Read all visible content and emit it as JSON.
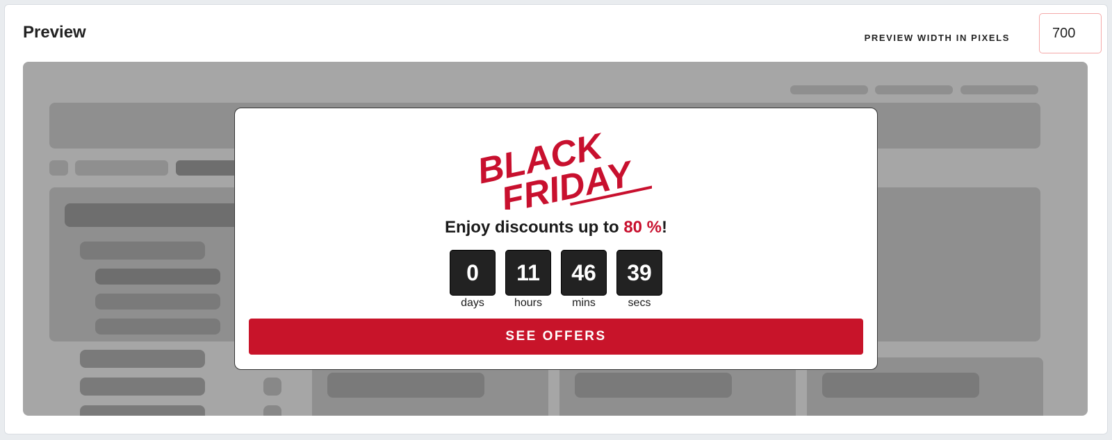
{
  "header": {
    "title": "Preview",
    "width_label": "PREVIEW WIDTH IN PIXELS",
    "width_value": "700"
  },
  "popup": {
    "logo_line1": "BLACK",
    "logo_line2": "FRIDAY",
    "headline_prefix": "Enjoy discounts up to ",
    "headline_highlight": "80 %",
    "headline_suffix": "!",
    "countdown": [
      {
        "value": "0",
        "label": "days"
      },
      {
        "value": "11",
        "label": "hours"
      },
      {
        "value": "46",
        "label": "mins"
      },
      {
        "value": "39",
        "label": "secs"
      }
    ],
    "cta_label": "SEE OFFERS"
  },
  "colors": {
    "brand_red": "#c8102e",
    "countdown_bg": "#222222",
    "skeleton_bg": "#a6a6a6"
  }
}
